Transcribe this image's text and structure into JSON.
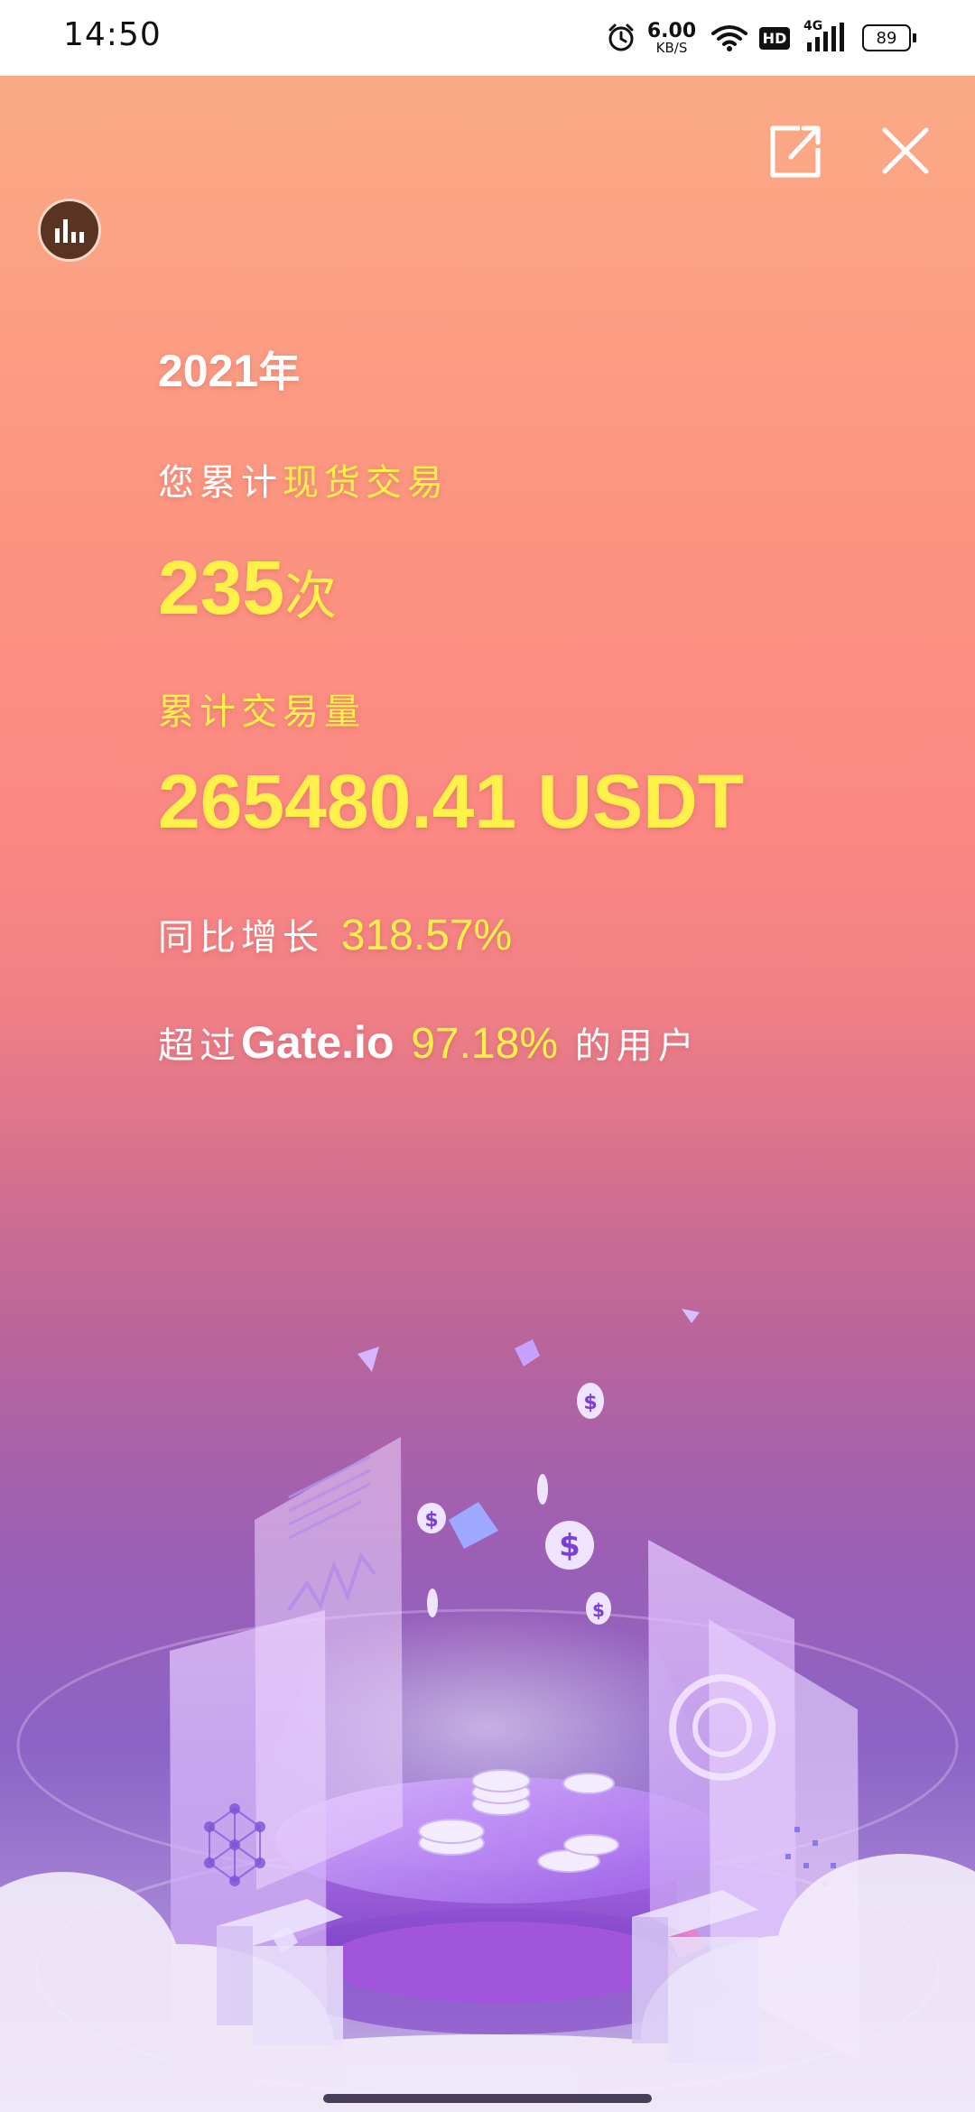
{
  "status_bar": {
    "time": "14:50",
    "net_speed_value": "6.00",
    "net_speed_unit": "KB/S",
    "hd_label": "HD",
    "signal_label": "4G",
    "battery": "89"
  },
  "report": {
    "year": "2021",
    "year_suffix": "年",
    "spot_prefix": "您累计",
    "spot_highlight": "现货交易",
    "trade_count": "235",
    "trade_count_unit": "次",
    "volume_label": "累计交易量",
    "volume_value": "265480.41 USDT",
    "growth_label": "同比增长",
    "growth_value": "318.57%",
    "exceed_prefix": "超过",
    "exceed_brand": "Gate.io",
    "exceed_value": "97.18%",
    "exceed_suffix": "的用户"
  },
  "icons": {
    "share": "share-icon",
    "close": "close-icon",
    "stats": "bar-chart-icon",
    "alarm": "alarm-icon",
    "wifi": "wifi-icon",
    "signal": "signal-icon",
    "battery": "battery-icon",
    "coin": "dollar-coin-icon"
  },
  "colors": {
    "highlight": "#fff04a",
    "text": "#ffffff",
    "gradient_top": "#fbaa86",
    "gradient_bottom": "#c7b3e6"
  }
}
